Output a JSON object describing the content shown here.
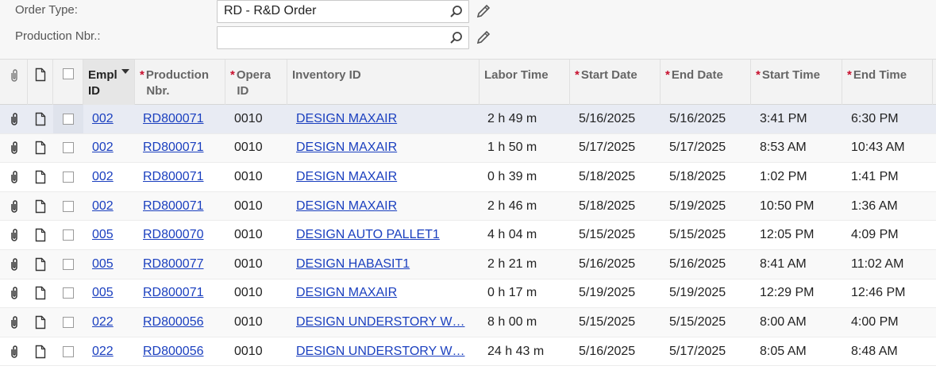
{
  "filters": {
    "order_type_label": "Order Type:",
    "order_type_value": "RD - R&D Order",
    "production_nbr_label": "Production Nbr.:",
    "production_nbr_value": ""
  },
  "grid": {
    "headers": {
      "empl_id_line1": "Empl",
      "empl_id_line2": "ID",
      "production_nbr_line1": "Production",
      "production_nbr_line2": "Nbr.",
      "operation_id_line1": "Opera",
      "operation_id_line2": "ID",
      "inventory_id": "Inventory ID",
      "labor_time": "Labor Time",
      "start_date": "Start Date",
      "end_date": "End Date",
      "start_time": "Start Time",
      "end_time": "End Time",
      "required_marker": "*"
    },
    "rows": [
      {
        "empl": "002",
        "prod": "RD800071",
        "op": "0010",
        "inv": "DESIGN MAXAIR",
        "labor": "2 h 49 m",
        "sdate": "5/16/2025",
        "edate": "5/16/2025",
        "stime": "3:41 PM",
        "etime": "6:30 PM"
      },
      {
        "empl": "002",
        "prod": "RD800071",
        "op": "0010",
        "inv": "DESIGN MAXAIR",
        "labor": "1 h 50 m",
        "sdate": "5/17/2025",
        "edate": "5/17/2025",
        "stime": "8:53 AM",
        "etime": "10:43 AM"
      },
      {
        "empl": "002",
        "prod": "RD800071",
        "op": "0010",
        "inv": "DESIGN MAXAIR",
        "labor": "0 h 39 m",
        "sdate": "5/18/2025",
        "edate": "5/18/2025",
        "stime": "1:02 PM",
        "etime": "1:41 PM"
      },
      {
        "empl": "002",
        "prod": "RD800071",
        "op": "0010",
        "inv": "DESIGN MAXAIR",
        "labor": "2 h 46 m",
        "sdate": "5/18/2025",
        "edate": "5/19/2025",
        "stime": "10:50 PM",
        "etime": "1:36 AM"
      },
      {
        "empl": "005",
        "prod": "RD800070",
        "op": "0010",
        "inv": "DESIGN AUTO PALLET1",
        "labor": "4 h 04 m",
        "sdate": "5/15/2025",
        "edate": "5/15/2025",
        "stime": "12:05 PM",
        "etime": "4:09 PM"
      },
      {
        "empl": "005",
        "prod": "RD800077",
        "op": "0010",
        "inv": "DESIGN HABASIT1",
        "labor": "2 h 21 m",
        "sdate": "5/16/2025",
        "edate": "5/16/2025",
        "stime": "8:41 AM",
        "etime": "11:02 AM"
      },
      {
        "empl": "005",
        "prod": "RD800071",
        "op": "0010",
        "inv": "DESIGN MAXAIR",
        "labor": "0 h 17 m",
        "sdate": "5/19/2025",
        "edate": "5/19/2025",
        "stime": "12:29 PM",
        "etime": "12:46 PM"
      },
      {
        "empl": "022",
        "prod": "RD800056",
        "op": "0010",
        "inv": "DESIGN UNDERSTORY W…",
        "labor": "8 h 00 m",
        "sdate": "5/15/2025",
        "edate": "5/15/2025",
        "stime": "8:00 AM",
        "etime": "4:00 PM"
      },
      {
        "empl": "022",
        "prod": "RD800056",
        "op": "0010",
        "inv": "DESIGN UNDERSTORY W…",
        "labor": "24 h 43 m",
        "sdate": "5/16/2025",
        "edate": "5/17/2025",
        "stime": "8:05 AM",
        "etime": "8:48 AM"
      }
    ]
  },
  "icons": {
    "search": "search-icon",
    "edit": "pencil-icon",
    "attachment": "paperclip-icon",
    "note": "note-icon",
    "checkbox": "checkbox"
  },
  "colors": {
    "link": "#1a3fbf",
    "required": "#c8102e",
    "selected_row": "#e8ebf3"
  }
}
